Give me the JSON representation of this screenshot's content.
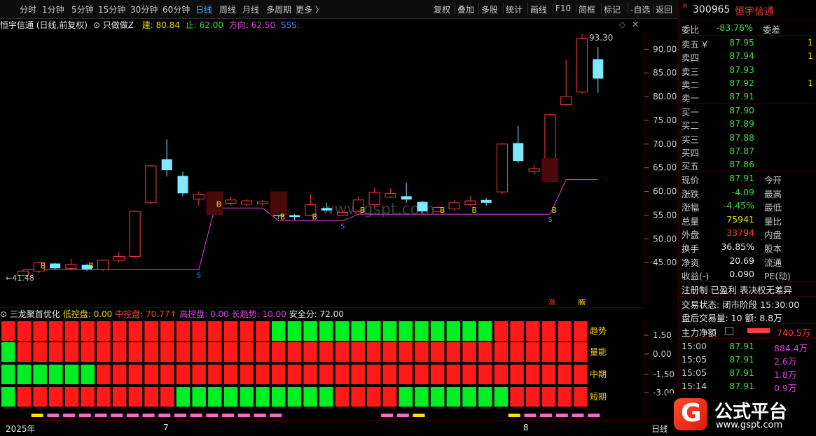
{
  "toolbar": {
    "periods": [
      "分时",
      "1分钟",
      "5分钟",
      "15分钟",
      "30分钟",
      "60分钟",
      "日线",
      "周线",
      "月线",
      "多周期",
      "更多 〉"
    ],
    "active_period": "日线",
    "tools": [
      "复权",
      "叠加",
      "多股",
      "统计",
      "画线",
      "F10",
      "简框",
      "标记",
      "-自选",
      "返回"
    ]
  },
  "info": {
    "stock_title": "恒宇信通 (日线,前复权)",
    "indicator_name": "只做做Z",
    "jian_label": "建: 80.84",
    "zhi_label": "止: 62.00",
    "fangxiang_label": "方向: 62.50",
    "sss_label": "SSS:"
  },
  "price_axis": {
    "labels": [
      "90.00",
      "85.00",
      "80.00",
      "75.00",
      "70.00",
      "65.00",
      "60.00",
      "55.00",
      "50.00",
      "45.00"
    ],
    "high_marker": "93.30",
    "low_marker": "41.48"
  },
  "markers": {
    "zhang": "涨",
    "teng": "腾"
  },
  "indicator": {
    "name": "三龙聚首优化",
    "di": "低控盘: 0.00",
    "zhong": "中控盘: 70.77↑",
    "gao": "高控盘: 0.00",
    "chang": "长趋势: 10.00",
    "anquan": "安全分: 72.00",
    "row_labels": [
      "趋势",
      "量能",
      "中期",
      "短期"
    ],
    "axis_labels": [
      "1.50",
      "0.00",
      "-1.50",
      "-3.00"
    ]
  },
  "time_axis": {
    "labels": [
      "2025年",
      "7",
      "8"
    ],
    "period_label": "日线"
  },
  "stock": {
    "code": "300965",
    "name": "恒宇信通",
    "badge": "R"
  },
  "orderbook": {
    "weibi_label": "委比",
    "weibi_value": "-83.76%",
    "weicha_label": "委差",
    "sells": [
      {
        "label": "卖五 ¥",
        "price": "87.95",
        "vol": "1"
      },
      {
        "label": "卖四",
        "price": "87.94",
        "vol": "1"
      },
      {
        "label": "卖三",
        "price": "87.93",
        "vol": ""
      },
      {
        "label": "卖二",
        "price": "87.92",
        "vol": "1"
      },
      {
        "label": "卖一",
        "price": "87.91",
        "vol": ""
      }
    ],
    "buys": [
      {
        "label": "买一",
        "price": "87.90"
      },
      {
        "label": "买二",
        "price": "87.89"
      },
      {
        "label": "买三",
        "price": "87.88"
      },
      {
        "label": "买四",
        "price": "87.87"
      },
      {
        "label": "买五",
        "price": "87.86"
      }
    ]
  },
  "quote": [
    {
      "l": "现价",
      "v": "87.91",
      "r": "今开",
      "c": "green"
    },
    {
      "l": "涨跌",
      "v": "-4.09",
      "r": "最高",
      "c": "green"
    },
    {
      "l": "涨幅",
      "v": "-4.45%",
      "r": "最低",
      "c": "green"
    },
    {
      "l": "总量",
      "v": "75941",
      "r": "量比",
      "c": "yellow"
    },
    {
      "l": "外盘",
      "v": "33794",
      "r": "内盘",
      "c": "red"
    },
    {
      "l": "换手",
      "v": "36.85%",
      "r": "股本",
      "c": "white"
    },
    {
      "l": "净资",
      "v": "20.69",
      "r": "流通",
      "c": "white"
    },
    {
      "l": "收益(-)",
      "v": "0.090",
      "r": "PE(动)",
      "c": "white"
    }
  ],
  "status": {
    "tags": "注册制 已盈利 表决权无差异",
    "state": "交易状态: 闭市阶段 15:30:00",
    "after": "盘后交易量: 10  额: 8.8万",
    "netflow_label": "主力净额",
    "netflow_value": "740.5万"
  },
  "ticks": [
    {
      "t": "15:00",
      "p": "87.91",
      "v": "884.4万"
    },
    {
      "t": "15:05",
      "p": "87.91",
      "v": "2.6万"
    },
    {
      "t": "15:05",
      "p": "87.91",
      "v": "1.8万"
    },
    {
      "t": "15:14",
      "p": "87.91",
      "v": "0.9万"
    }
  ],
  "watermark": {
    "site": "www.gspt.com",
    "logo_title": "公式平台",
    "logo_url": "www.gspt.com",
    "logo_mark": "G"
  },
  "colors": {
    "up": "#ff3b3b",
    "down": "#3ddc3d",
    "cyan": "#7fe9ff",
    "magenta": "#e040e0",
    "yellow": "#e8d800",
    "bg": "#000000"
  },
  "chart_data": {
    "type": "candlestick",
    "ylim": [
      41.48,
      93.3
    ],
    "candles": [
      {
        "o": 42.3,
        "c": 43.2,
        "h": 43.6,
        "l": 42.0
      },
      {
        "o": 43.2,
        "c": 45.0,
        "h": 45.2,
        "l": 42.8
      },
      {
        "o": 44.8,
        "c": 43.8,
        "h": 45.0,
        "l": 43.5
      },
      {
        "o": 43.8,
        "c": 44.6,
        "h": 45.8,
        "l": 43.4
      },
      {
        "o": 44.5,
        "c": 43.6,
        "h": 44.8,
        "l": 43.2
      },
      {
        "o": 43.5,
        "c": 45.5,
        "h": 45.6,
        "l": 43.2
      },
      {
        "o": 45.5,
        "c": 46.3,
        "h": 47.3,
        "l": 45.0
      },
      {
        "o": 46.3,
        "c": 55.8,
        "h": 56.0,
        "l": 46.0
      },
      {
        "o": 57.6,
        "c": 65.4,
        "h": 65.6,
        "l": 57.3
      },
      {
        "o": 66.8,
        "c": 64.5,
        "h": 71.0,
        "l": 63.2
      },
      {
        "o": 63.3,
        "c": 59.6,
        "h": 64.2,
        "l": 59.0
      },
      {
        "o": 58.4,
        "c": 59.4,
        "h": 60.0,
        "l": 57.0
      },
      {
        "o": 57.8,
        "c": 58.6,
        "h": 59.0,
        "l": 57.2
      },
      {
        "o": 57.5,
        "c": 58.2,
        "h": 59.0,
        "l": 57.0
      },
      {
        "o": 57.3,
        "c": 58.0,
        "h": 58.4,
        "l": 56.8
      },
      {
        "o": 57.4,
        "c": 57.8,
        "h": 58.2,
        "l": 57.0
      },
      {
        "o": 56.0,
        "c": 54.8,
        "h": 56.5,
        "l": 54.2
      },
      {
        "o": 55.0,
        "c": 54.6,
        "h": 55.2,
        "l": 54.0
      },
      {
        "o": 55.0,
        "c": 57.2,
        "h": 59.5,
        "l": 54.8
      },
      {
        "o": 56.5,
        "c": 56.0,
        "h": 57.6,
        "l": 55.8
      },
      {
        "o": 55.0,
        "c": 55.6,
        "h": 56.0,
        "l": 54.8
      },
      {
        "o": 55.8,
        "c": 58.2,
        "h": 59.0,
        "l": 55.4
      },
      {
        "o": 57.2,
        "c": 59.8,
        "h": 60.8,
        "l": 56.8
      },
      {
        "o": 58.8,
        "c": 59.6,
        "h": 60.6,
        "l": 58.6
      },
      {
        "o": 59.0,
        "c": 58.3,
        "h": 61.8,
        "l": 57.6
      },
      {
        "o": 57.8,
        "c": 55.8,
        "h": 58.0,
        "l": 55.4
      },
      {
        "o": 55.8,
        "c": 56.6,
        "h": 57.0,
        "l": 55.6
      },
      {
        "o": 56.3,
        "c": 57.6,
        "h": 58.2,
        "l": 56.0
      },
      {
        "o": 57.2,
        "c": 58.0,
        "h": 59.0,
        "l": 56.9
      },
      {
        "o": 58.2,
        "c": 57.6,
        "h": 58.6,
        "l": 57.0
      },
      {
        "o": 59.9,
        "c": 70.0,
        "h": 70.2,
        "l": 59.5
      },
      {
        "o": 70.2,
        "c": 66.4,
        "h": 73.8,
        "l": 66.0
      },
      {
        "o": 64.2,
        "c": 64.8,
        "h": 65.6,
        "l": 63.6
      },
      {
        "o": 64.5,
        "c": 76.2,
        "h": 76.4,
        "l": 64.0
      },
      {
        "o": 78.3,
        "c": 80.0,
        "h": 87.8,
        "l": 78.0
      },
      {
        "o": 81.0,
        "c": 92.2,
        "h": 93.3,
        "l": 80.6
      },
      {
        "o": 87.9,
        "c": 83.8,
        "h": 90.5,
        "l": 80.8
      }
    ],
    "signal_line": [
      43.5,
      43.5,
      43.5,
      43.5,
      43.5,
      43.5,
      43.5,
      43.5,
      43.5,
      43.5,
      43.5,
      43.5,
      56.5,
      56.5,
      56.5,
      56.5,
      53.8,
      53.8,
      53.8,
      53.8,
      53.8,
      55.2,
      55.2,
      55.2,
      55.2,
      55.2,
      55.2,
      55.2,
      55.2,
      55.2,
      55.2,
      55.2,
      55.2,
      55.2,
      62.5,
      62.5,
      62.5
    ],
    "indicator_grid": {
      "trend": "RRRRRRRRRRRRRRRRRGGGGGGGGGGGGGGRRRRRRR",
      "volume": "GRRRRRRRRRRRRRRRRRRRRRRRRRRRRRRRRRRRRR",
      "mid": "GGGGGGRRRRRRRRRRRRRRRRRRRRRRRRRRRRRRRR",
      "short": "GRRRRRRRRRRGGGGGGGGGGRRRRGGGGGGGRRRRRR"
    }
  }
}
